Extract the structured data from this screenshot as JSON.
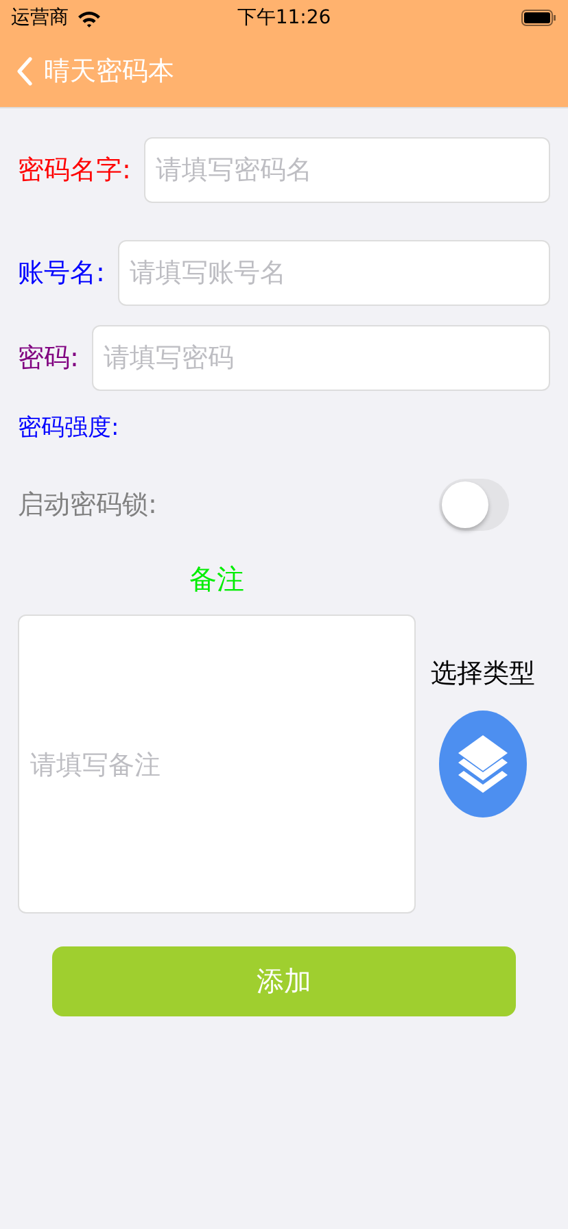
{
  "status_bar": {
    "carrier": "运营商",
    "time": "下午11:26"
  },
  "nav": {
    "title": "晴天密码本"
  },
  "fields": [
    {
      "label": "密码名字:",
      "color": "#ff0000",
      "placeholder": "请填写密码名"
    },
    {
      "label": "账号名:",
      "color": "#0000ff",
      "placeholder": "请填写账号名"
    },
    {
      "label": "密码:",
      "color": "#800080",
      "placeholder": "请填写密码"
    }
  ],
  "strength": {
    "label": "密码强度:",
    "color": "#0000ff"
  },
  "lock": {
    "label": "启动密码锁:",
    "on": false
  },
  "note": {
    "title": "备注",
    "placeholder": "请填写备注"
  },
  "type_picker": {
    "label": "选择类型"
  },
  "add_button": "添加"
}
